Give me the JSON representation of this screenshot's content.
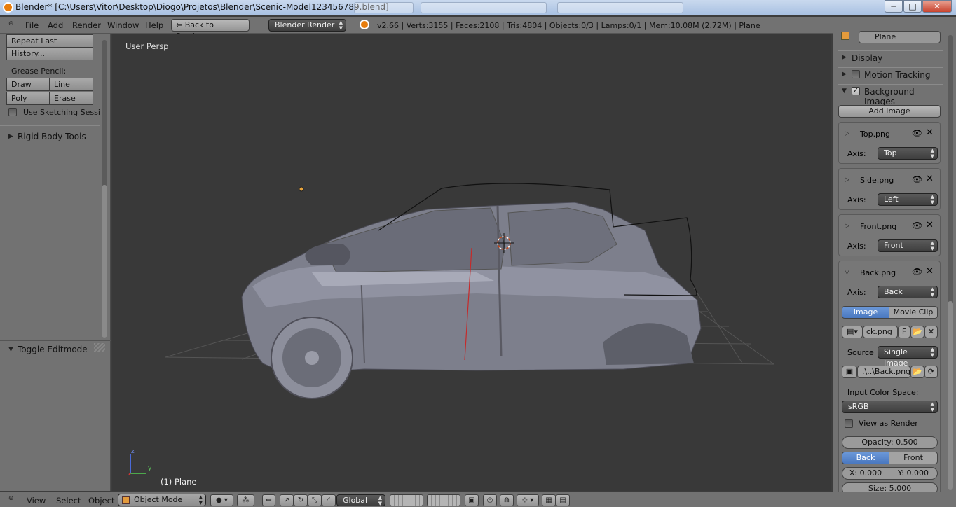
{
  "window": {
    "title": "Blender* [C:\\Users\\Vitor\\Desktop\\Diogo\\Projetos\\Blender\\Scenic-Model123456789.blend]",
    "minimize": "─",
    "maximize": "□",
    "close": "✕"
  },
  "info": {
    "menus": [
      "File",
      "Add",
      "Render",
      "Window",
      "Help"
    ],
    "back_button": "Back to Previous",
    "render_engine": "Blender Render",
    "stats": "v2.66 | Verts:3155 | Faces:2108 | Tris:4804 | Objects:0/3 | Lamps:0/1 | Mem:10.08M (2.72M) | Plane"
  },
  "toolbar": {
    "repeat_last": "Repeat Last",
    "history": "History...",
    "grease_pencil_label": "Grease Pencil:",
    "draw": "Draw",
    "line": "Line",
    "poly": "Poly",
    "erase": "Erase",
    "use_sketching": "Use Sketching Sessi",
    "rigid_body_tools": "Rigid Body Tools",
    "toggle_editmode": "Toggle Editmode"
  },
  "viewport": {
    "view_label": "User Persp",
    "object_label": "(1) Plane",
    "axis_y": "y",
    "axis_z": "z"
  },
  "properties": {
    "object_name": "Plane",
    "display": "Display",
    "motion_tracking": "Motion Tracking",
    "background_images": "Background Images",
    "add_image": "Add Image",
    "axis_label": "Axis:",
    "images": [
      {
        "name": "Top.png",
        "axis": "Top",
        "expanded": false
      },
      {
        "name": "Side.png",
        "axis": "Left",
        "expanded": false
      },
      {
        "name": "Front.png",
        "axis": "Front",
        "expanded": false
      },
      {
        "name": "Back.png",
        "axis": "Back",
        "expanded": true
      }
    ],
    "source_tabs": {
      "image": "Image",
      "movie_clip": "Movie Clip"
    },
    "image_file": "ck.png",
    "fake_user": "F",
    "source_label": "Source",
    "source_value": "Single Image",
    "filepath": ".\\..\\Back.png",
    "input_color_space_label": "Input Color Space:",
    "color_space": "sRGB",
    "view_as_render": "View as Render",
    "opacity": "Opacity: 0.500",
    "opacity_value": 0.5,
    "back": "Back",
    "front": "Front",
    "x": "X: 0.000",
    "y": "Y: 0.000",
    "size": "Size: 5.000"
  },
  "bottom": {
    "view": "View",
    "select": "Select",
    "object": "Object",
    "mode": "Object Mode",
    "orientation": "Global"
  },
  "colors": {
    "accent_blue": "#5682c9",
    "panel": "#727272",
    "viewport": "#393939"
  }
}
